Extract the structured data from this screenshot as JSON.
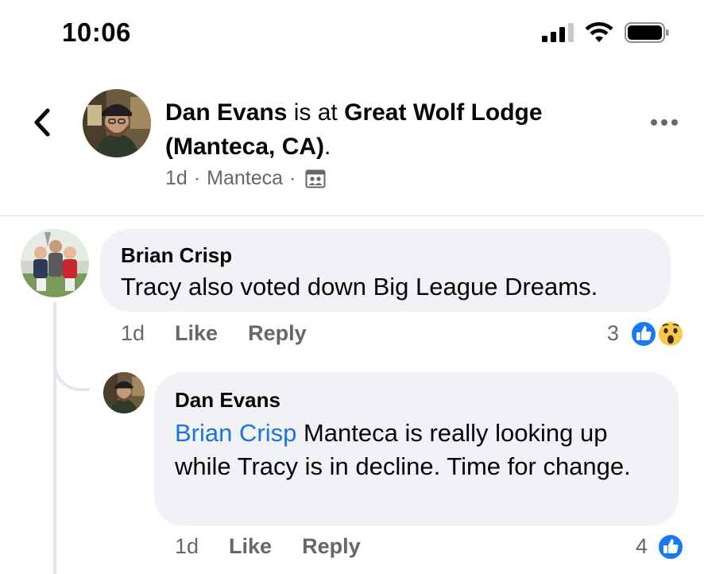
{
  "status_bar": {
    "time": "10:06"
  },
  "post": {
    "author": "Dan Evans",
    "connector": " is at ",
    "place": "Great Wolf Lodge (Manteca, CA)",
    "trailing": ".",
    "age": "1d",
    "location": "Manteca",
    "separator": "·",
    "audience_icon": "friends-photo-icon"
  },
  "comments": [
    {
      "author": "Brian Crisp",
      "text": "Tracy also voted down Big League Dreams.",
      "age": "1d",
      "like_label": "Like",
      "reply_label": "Reply",
      "reaction_count": "3",
      "reactions": [
        "like",
        "wow"
      ]
    },
    {
      "author": "Dan Evans",
      "mention": "Brian Crisp",
      "text": " Manteca is really looking up while Tracy is in decline. Time for change.",
      "age": "1d",
      "like_label": "Like",
      "reply_label": "Reply",
      "reaction_count": "4",
      "reactions": [
        "like"
      ]
    }
  ],
  "colors": {
    "link_blue": "#1b74e4",
    "like_blue": "#1877f2",
    "bubble_gray": "#f0f2f5",
    "meta_gray": "#65676b"
  }
}
